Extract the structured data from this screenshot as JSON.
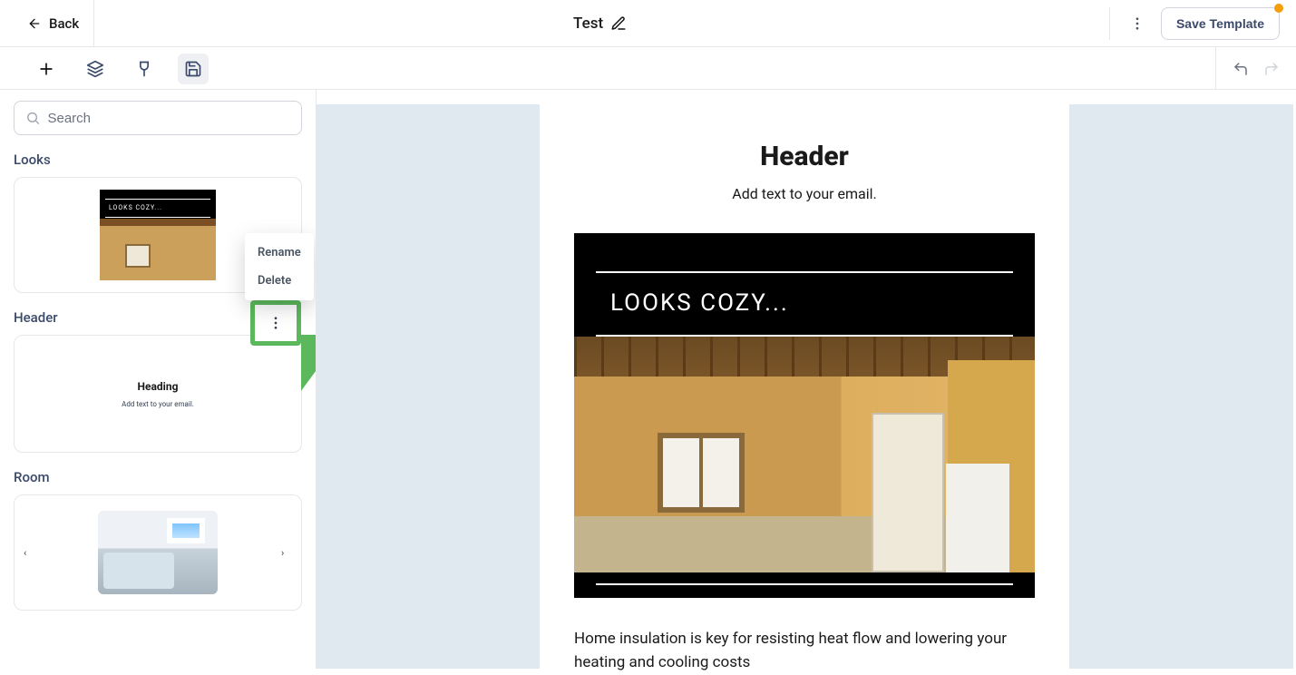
{
  "topbar": {
    "back_label": "Back",
    "doc_title": "Test",
    "save_label": "Save Template"
  },
  "search": {
    "placeholder": "Search"
  },
  "sidebar": {
    "sections": [
      {
        "title": "Looks",
        "thumb_caption": "LOOKS COZY..."
      },
      {
        "title": "Header",
        "thumb_heading": "Heading",
        "thumb_text": "Add text to your email."
      },
      {
        "title": "Room"
      }
    ]
  },
  "context_menu": {
    "rename": "Rename",
    "delete": "Delete"
  },
  "email": {
    "header": "Header",
    "subline": "Add text to your email.",
    "hero_caption": "LOOKS COZY...",
    "body": "Home insulation is key for resisting heat flow and lowering your heating and cooling costs"
  }
}
